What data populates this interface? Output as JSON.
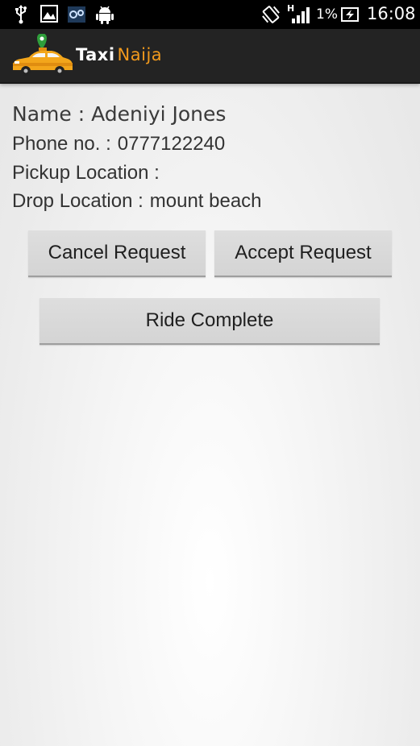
{
  "status_bar": {
    "battery": "1%",
    "time": "16:08",
    "network_type": "H",
    "icons": [
      "usb-icon",
      "image-icon",
      "settings-icon",
      "android-icon",
      "vibrate-icon",
      "signal-icon",
      "battery-charging-icon"
    ]
  },
  "app_bar": {
    "brand_first": "Taxi",
    "brand_second": "Naija",
    "brand_color": "#f29a1d",
    "logo_icon": "taxi-car-icon"
  },
  "details": {
    "name_label": "Name :",
    "name_value": "Adeniyi Jones",
    "phone_label": "Phone no. :",
    "phone_value": "0777122240",
    "pickup_label": "Pickup Location :",
    "pickup_value": "",
    "drop_label": "Drop Location :",
    "drop_value": "mount beach"
  },
  "actions": {
    "cancel_label": "Cancel Request",
    "accept_label": "Accept Request",
    "complete_label": "Ride Complete"
  }
}
